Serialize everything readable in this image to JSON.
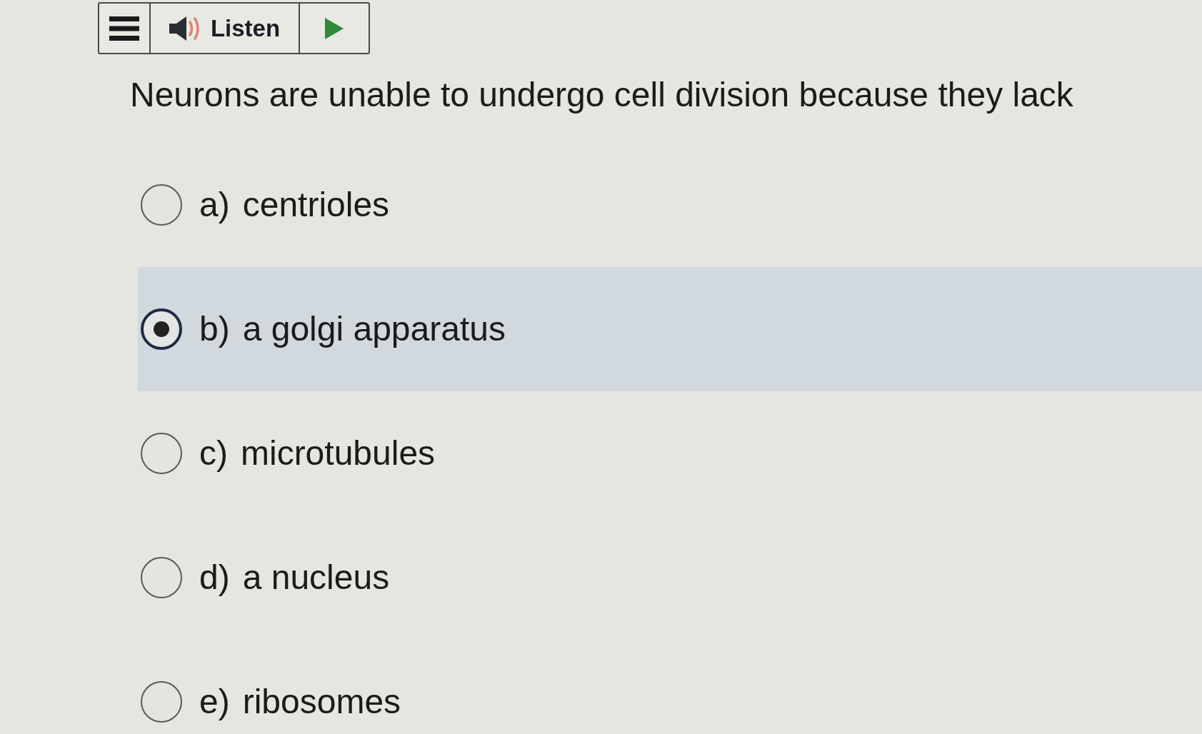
{
  "toolbar": {
    "listen_label": "Listen"
  },
  "question": "Neurons are unable to undergo cell division because they lack",
  "options": [
    {
      "letter": "a)",
      "text": "centrioles",
      "selected": false
    },
    {
      "letter": "b)",
      "text": "a golgi apparatus",
      "selected": true
    },
    {
      "letter": "c)",
      "text": "microtubules",
      "selected": false
    },
    {
      "letter": "d)",
      "text": "a nucleus",
      "selected": false
    },
    {
      "letter": "e)",
      "text": "ribosomes",
      "selected": false
    }
  ]
}
